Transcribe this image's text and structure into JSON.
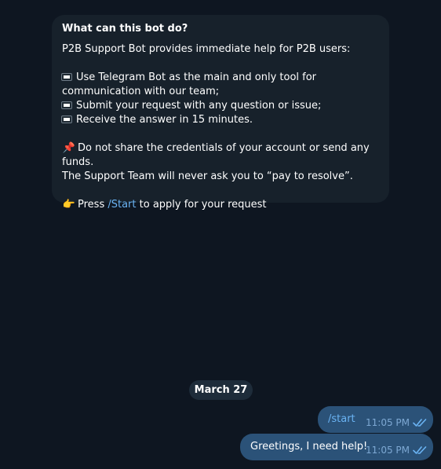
{
  "bot_info": {
    "title": "What can this bot do?",
    "intro": "P2B Support Bot provides immediate help for P2B users:",
    "bullets": [
      "Use Telegram Bot as the main and only tool for communication with our team;",
      "Submit your request with any question or issue;",
      "Receive the answer in 15 minutes."
    ],
    "warning_line1": "Do not share the credentials of your account or send any funds.",
    "warning_line2": "The Support Team will never ask you to “pay to resolve”.",
    "cta_prefix": "Press ",
    "cta_link": "/Start",
    "cta_suffix": " to apply for your request",
    "icons": {
      "bullet": "phone-icon",
      "warning": "pushpin-icon",
      "cta": "pointing-hand-icon"
    }
  },
  "date_separator": "March 27",
  "messages": [
    {
      "text": "/start",
      "time": "11:05 PM",
      "status": "read"
    },
    {
      "text": "Greetings, I need help!",
      "time": "11:05 PM",
      "status": "read"
    }
  ],
  "colors": {
    "background": "#0e1621",
    "bot_card": "#17212b",
    "outgoing_bubble": "#2b5278",
    "link": "#6ab3f3",
    "meta": "#7da8d3"
  }
}
